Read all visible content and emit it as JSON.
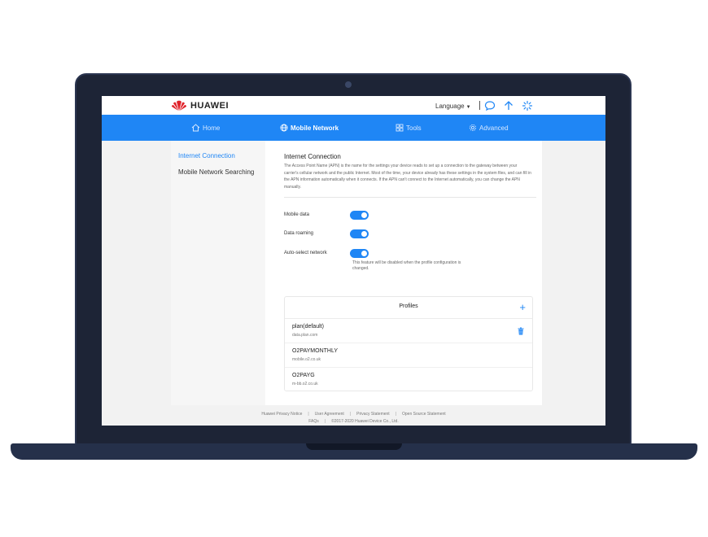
{
  "header": {
    "brand": "HUAWEI",
    "language_label": "Language",
    "brand_color": "#e0232b",
    "icons": [
      "message-icon",
      "upload-arrow-icon",
      "loading-spinner-icon"
    ]
  },
  "nav": {
    "items": [
      {
        "label": "Home",
        "icon": "home-icon"
      },
      {
        "label": "Mobile Network",
        "icon": "globe-icon",
        "active": true
      },
      {
        "label": "Tools",
        "icon": "tools-icon"
      },
      {
        "label": "Advanced",
        "icon": "gear-icon"
      }
    ],
    "color": "#1f86f5"
  },
  "sidebar": {
    "items": [
      {
        "label": "Internet Connection",
        "active": true
      },
      {
        "label": "Mobile Network Searching",
        "active": false
      }
    ]
  },
  "main": {
    "title": "Internet Connection",
    "description": "The Access Point Name (APN) is the name for the settings your device reads to set up a connection to the gateway between your carrier's cellular network and the public Internet. Most of the time, your device already has these settings in the system files, and can fill in the APN information automatically when it connects. If the APN can't connect to the Internet automatically, you can change the APN manually.",
    "settings": [
      {
        "label": "Mobile data",
        "enabled": true
      },
      {
        "label": "Data roaming",
        "enabled": true
      },
      {
        "label": "Auto-select network",
        "enabled": true
      }
    ],
    "auto_select_note": "This feature will be disabled when the profile configuration is changed."
  },
  "profiles": {
    "title": "Profiles",
    "add_icon": "plus-icon",
    "items": [
      {
        "name": "plan(default)",
        "apn": "data.plan.com",
        "deletable": true
      },
      {
        "name": "O2PAYMONTHLY",
        "apn": "mobile.o2.co.uk",
        "deletable": false
      },
      {
        "name": "O2PAYG",
        "apn": "m-bb.o2.co.uk",
        "deletable": false
      }
    ]
  },
  "footer": {
    "links": [
      "Huawei Privacy Notice",
      "User Agreement",
      "Privacy Statement",
      "Open Source Statement"
    ],
    "faqs": "FAQs",
    "copyright": "©2017-2020 Huawei Device Co., Ltd."
  }
}
